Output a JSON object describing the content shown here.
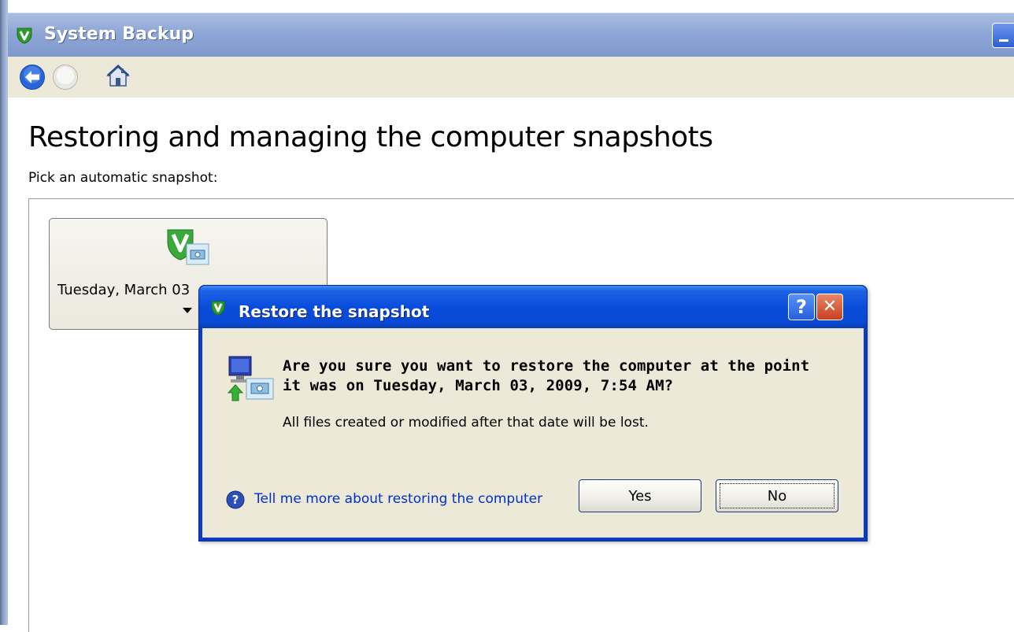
{
  "window": {
    "title": "System Backup"
  },
  "toolbar": {
    "back_icon": "back-arrow-icon",
    "forward_icon": "forward-circle-icon",
    "home_icon": "home-icon"
  },
  "main": {
    "heading": "Restoring and managing the computer snapshots",
    "subtitle": "Pick an automatic snapshot:",
    "snapshots": [
      {
        "label": "Tuesday, March 03",
        "icon": "snapshot-icon"
      }
    ]
  },
  "dialog": {
    "title": "Restore the snapshot",
    "help_caption": "?",
    "close_caption": "✕",
    "question": "Are you sure you want to restore the computer at the point it was on Tuesday, March 03, 2009, 7:54 AM?",
    "info": "All files created or modified after that date will be lost.",
    "help_link": "Tell me more about restoring the computer",
    "yes_label": "Yes",
    "no_label": "No"
  },
  "colors": {
    "accent_green": "#3aa83a",
    "dialog_title_blue": "#0a4ddb",
    "link_blue": "#0030c8"
  }
}
